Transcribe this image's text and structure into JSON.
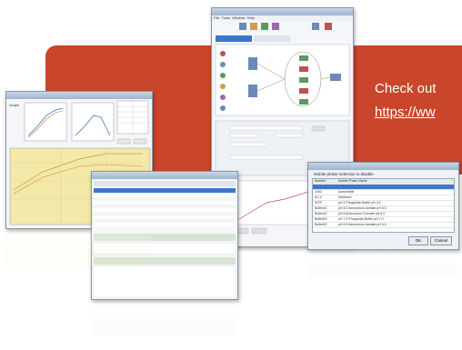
{
  "banner": {
    "line1": "Check out",
    "line2": "https://ww"
  },
  "window_charts": {
    "title": "",
    "left_label": "Graph",
    "chart_titles": [
      "",
      ""
    ],
    "button_labels": [
      "",
      ""
    ]
  },
  "window_main": {
    "menu": [
      "File",
      "Tools",
      "Window",
      "Help"
    ],
    "tabs": [
      "",
      ""
    ],
    "options_label": "Options"
  },
  "window_table": {
    "headers": [
      "",
      "",
      "",
      "",
      "",
      ""
    ],
    "rows": 9
  },
  "window_dialog": {
    "title": "Mobile phase selection is disable",
    "col1": "Number",
    "col2": "Mobile Phase Name",
    "items": [
      {
        "num": "1002",
        "name": "Acetonitrile"
      },
      {
        "num": "AC-3",
        "name": "Methanol"
      },
      {
        "num": "WTR",
        "name": "pH 2 Phosphate Buffer pH 3.0"
      },
      {
        "num": "BufferA1",
        "name": "pH 6.0 Ammonium Acetate pH 6.0"
      },
      {
        "num": "BufferA2",
        "name": "pH 8 Ammonium Formate pH 8.0"
      },
      {
        "num": "BufferB1",
        "name": "pH 7.0 Phosphate Buffer pH 7.0"
      },
      {
        "num": "BufferB2",
        "name": "pH 6.5 Ammonium Acetate pH 6.5"
      }
    ],
    "ok_label": "OK",
    "cancel_label": "Cancel"
  },
  "colors": {
    "banner": "#c9452c",
    "selection": "#3a78c8",
    "chart_fill": "#f3e9a8"
  }
}
